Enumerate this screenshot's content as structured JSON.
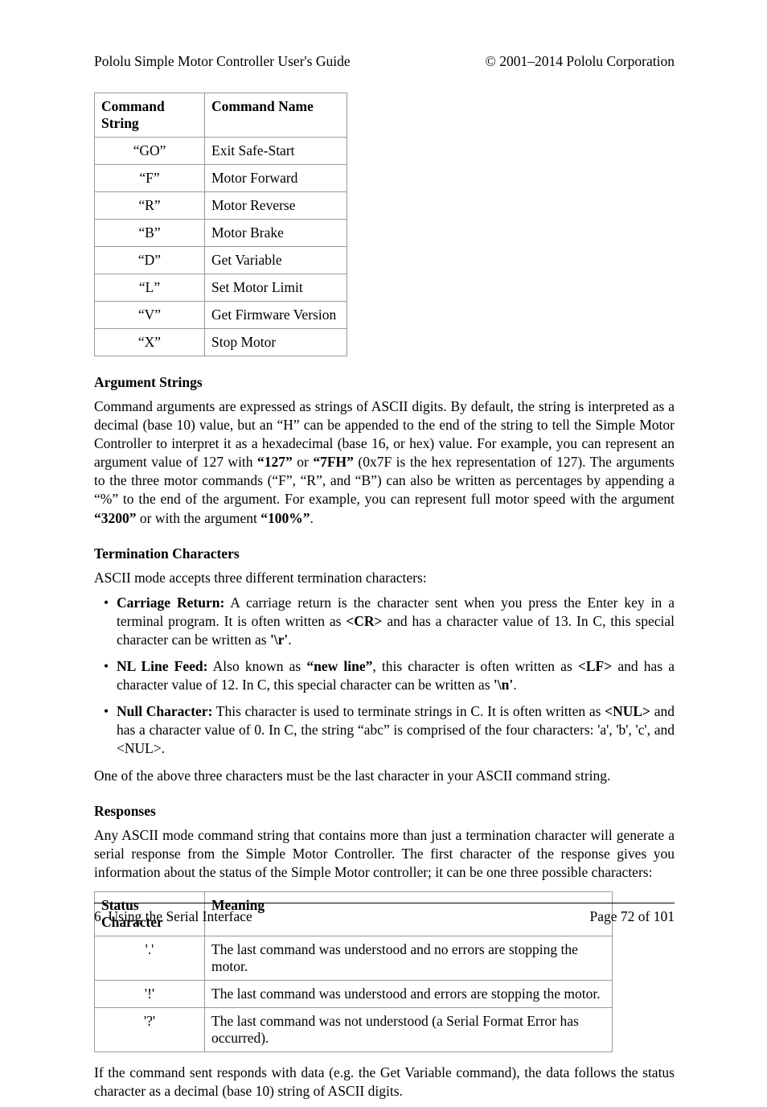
{
  "header": {
    "left": "Pololu Simple Motor Controller User's Guide",
    "right": "© 2001–2014 Pololu Corporation"
  },
  "command_table": {
    "headers": [
      "Command String",
      "Command Name"
    ],
    "rows": [
      {
        "string": "“GO”",
        "name": "Exit Safe-Start"
      },
      {
        "string": "“F”",
        "name": "Motor Forward"
      },
      {
        "string": "“R”",
        "name": "Motor Reverse"
      },
      {
        "string": "“B”",
        "name": "Motor Brake"
      },
      {
        "string": "“D”",
        "name": "Get Variable"
      },
      {
        "string": "“L”",
        "name": "Set Motor Limit"
      },
      {
        "string": "“V”",
        "name": "Get Firmware Version"
      },
      {
        "string": "“X”",
        "name": "Stop Motor"
      }
    ]
  },
  "sections": {
    "argument_strings": {
      "title": "Argument Strings",
      "p1a": "Command arguments are expressed as strings of ASCII digits. By default, the string is interpreted as a decimal (base 10) value, but an “H” can be appended to the end of the string to tell the Simple Motor Controller to interpret it as a hexadecimal (base 16, or hex) value. For example, you can represent an argument value of 127 with ",
      "b1": "“127”",
      "or": " or ",
      "b2": "“7FH”",
      "p1b": " (0x7F is the hex representation of 127). The arguments to the three motor commands (“F”, “R”, and “B”) can also be written as percentages by appending a “%” to the end of the argument. For example, you can represent full motor speed with the argument ",
      "b3": "“3200”",
      "p1c": " or with the argument ",
      "b4": "“100%”",
      "p1d": "."
    },
    "termination": {
      "title": "Termination Characters",
      "intro": "ASCII mode accepts three different termination characters:",
      "items": {
        "cr": {
          "label": "Carriage Return:",
          "t1": " A carriage return is the character sent when you press the Enter key in a terminal program. It is often written as ",
          "b1": "<CR>",
          "t2": " and has a character value of 13. In C, this special character can be written as ",
          "b2": "'\\r'",
          "t3": "."
        },
        "lf": {
          "label": "NL Line Feed:",
          "t1": " Also known as ",
          "b1": "“new line”",
          "t2": ", this character is often written as ",
          "b2": "<LF>",
          "t3": " and has a character value of 12. In C, this special character can be written as ",
          "b3": "'\\n'",
          "t4": "."
        },
        "nul": {
          "label": "Null Character:",
          "t1": " This character is used to terminate strings in C. It is often written as ",
          "b1": "<NUL>",
          "t2": " and has a character value of 0. In C, the string “abc” is comprised of the four characters: 'a', 'b', 'c', and <NUL>."
        }
      },
      "outro": "One of the above three characters must be the last character in your ASCII command string."
    },
    "responses": {
      "title": "Responses",
      "intro": "Any ASCII mode command string that contains more than just a termination character will generate a serial response from the Simple Motor Controller. The first character of the response gives you information about the status of the Simple Motor controller; it can be one three possible characters:",
      "outro": "If the command sent responds with data (e.g. the Get Variable command), the data follows the status character as a decimal (base 10) string of ASCII digits."
    }
  },
  "status_table": {
    "headers": [
      "Status Character",
      "Meaning"
    ],
    "rows": [
      {
        "char": "'.'",
        "meaning": "The last command was understood and no errors are stopping the motor."
      },
      {
        "char": "'!'",
        "meaning": "The last command was understood and errors are stopping the motor."
      },
      {
        "char": "'?'",
        "meaning": "The last command was not understood (a Serial Format Error has occurred)."
      }
    ]
  },
  "footer": {
    "left": "6. Using the Serial Interface",
    "right": "Page 72 of 101"
  }
}
